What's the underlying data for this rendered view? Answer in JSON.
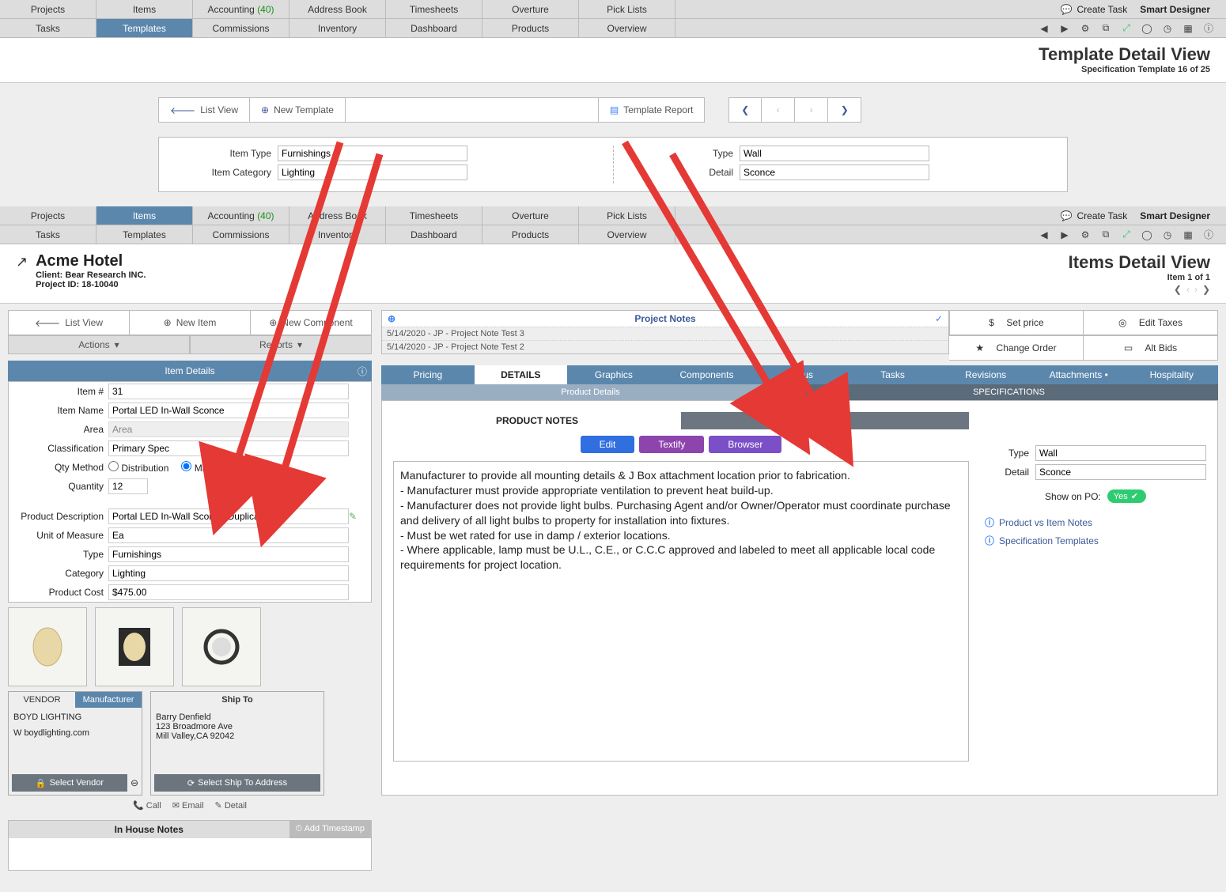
{
  "nav": {
    "row1": [
      "Projects",
      "Items",
      "Accounting",
      "Address Book",
      "Timesheets",
      "Overture",
      "Pick Lists"
    ],
    "row2": [
      "Tasks",
      "Templates",
      "Commissions",
      "Inventory",
      "Dashboard",
      "Products",
      "Overview"
    ],
    "accounting_count": "(40)",
    "active_top": "Templates",
    "create_task": "Create Task",
    "brand": "Smart Designer"
  },
  "template_view": {
    "title": "Template Detail View",
    "sub": "Specification Template 16 of 25",
    "btn_list": "List View",
    "btn_new": "New Template",
    "btn_report": "Template Report",
    "fields": {
      "item_type_label": "Item Type",
      "item_type": "Furnishings",
      "item_category_label": "Item Category",
      "item_category": "Lighting",
      "type_label": "Type",
      "type": "Wall",
      "detail_label": "Detail",
      "detail": "Sconce"
    }
  },
  "items_nav": {
    "active": "Items"
  },
  "project": {
    "name": "Acme Hotel",
    "client": "Client: Bear Research INC.",
    "projid": "Project ID: 18-10040",
    "view_title": "Items Detail View",
    "view_sub": "Item 1 of 1"
  },
  "left_actions": {
    "list": "List View",
    "new_item": "New Item",
    "new_comp": "New Component",
    "actions": "Actions",
    "reports": "Reports"
  },
  "item": {
    "panel_title": "Item Details",
    "item_num_l": "Item #",
    "item_num": "31",
    "item_name_l": "Item Name",
    "item_name": "Portal LED In-Wall Sconce",
    "area_l": "Area",
    "area": "Area",
    "class_l": "Classification",
    "class": "Primary Spec",
    "qtym_l": "Qty Method",
    "qtym_dist": "Distribution",
    "qtym_man": "Manual",
    "qty_l": "Quantity",
    "qty": "12",
    "pdesc_l": "Product Description",
    "pdesc": "Portal LED In-Wall Sconce-Duplicate",
    "uom_l": "Unit of Measure",
    "uom": "Ea",
    "type_l": "Type",
    "type": "Furnishings",
    "cat_l": "Category",
    "cat": "Lighting",
    "cost_l": "Product Cost",
    "cost": "$475.00"
  },
  "vendor": {
    "tab_vendor": "VENDOR",
    "tab_mfr": "Manufacturer",
    "name": "BOYD LIGHTING",
    "web": "W boydlighting.com",
    "btn": "Select Vendor",
    "call": "Call",
    "email": "Email",
    "detail": "Detail"
  },
  "shipto": {
    "title": "Ship To",
    "name": "Barry Denfield",
    "addr1": "123 Broadmore Ave",
    "addr2": "Mill Valley,CA 92042",
    "btn": "Select Ship To Address"
  },
  "inhouse": {
    "title": "In House Notes",
    "addts": "Add Timestamp"
  },
  "projnotes": {
    "title": "Project Notes",
    "n1": "5/14/2020 - JP - Project Note Test 3",
    "n2": "5/14/2020 - JP - Project Note Test 2"
  },
  "ractions": {
    "price": "Set price",
    "taxes": "Edit Taxes",
    "change": "Change Order",
    "alt": "Alt Bids"
  },
  "bigtabs": [
    "Pricing",
    "DETAILS",
    "Graphics",
    "Components",
    "Status",
    "Tasks",
    "Revisions",
    "Attachments •",
    "Hospitality"
  ],
  "subtabs": {
    "left": "Product Details",
    "right": "SPECIFICATIONS"
  },
  "sections": {
    "pnotes": "PRODUCT NOTES",
    "inotes": "Item Notes"
  },
  "pnactions": {
    "edit": "Edit",
    "textify": "Textify",
    "browser": "Browser"
  },
  "notes_body": "Manufacturer to provide all mounting details & J Box attachment location prior to fabrication.\n- Manufacturer must provide appropriate ventilation to prevent heat build-up.\n- Manufacturer does not provide light bulbs. Purchasing Agent and/or Owner/Operator must coordinate purchase and delivery of all light bulbs to property for installation into fixtures.\n- Must be wet rated for use in damp / exterior locations.\n- Where applicable, lamp must be U.L., C.E., or C.C.C approved and labeled to meet all applicable local code requirements for project location.",
  "spec": {
    "type_l": "Type",
    "type": "Wall",
    "detail_l": "Detail",
    "detail": "Sconce",
    "showpo_l": "Show on PO:",
    "showpo_v": "Yes",
    "link1": "Product vs Item Notes",
    "link2": "Specification Templates"
  }
}
